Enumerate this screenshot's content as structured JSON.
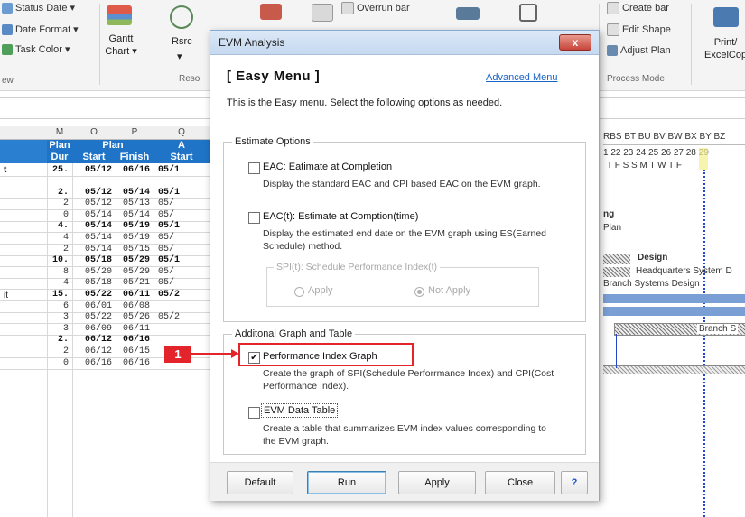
{
  "ribbon": {
    "status_date": "Status Date",
    "date_format": "Date Format",
    "task_color": "Task Color",
    "gantt_chart_line1": "Gantt",
    "gantt_chart_line2": "Chart",
    "rsrc": "Rsrc",
    "reso_group": "Reso",
    "overrun_bar": "Overrun bar",
    "create_bar": "Create bar",
    "edit_shape": "Edit Shape",
    "adjust_plan": "Adjust Plan",
    "process_mode": "Process Mode",
    "print_line1": "Print/",
    "print_line2": "ExcelCop",
    "view_group": "ew"
  },
  "sheet": {
    "col_letters": [
      "M",
      "O",
      "P",
      "Q"
    ],
    "header_plan": "Plan",
    "header_plan2": "Plan",
    "header_a": "A",
    "header_dur": "Dur",
    "header_start": "Start",
    "header_finish": "Finish",
    "header_start2": "Start",
    "total_marker": "t",
    "row_marker": "it",
    "rows": [
      {
        "dur": "25.",
        "start": "05/12",
        "finish": "06/16",
        "start2": "05/1",
        "bold": true
      },
      {
        "dur": "2.",
        "start": "05/12",
        "finish": "05/14",
        "start2": "05/1",
        "bold": true
      },
      {
        "dur": "2",
        "start": "05/12",
        "finish": "05/13",
        "start2": "05/",
        "bold": false
      },
      {
        "dur": "0",
        "start": "05/14",
        "finish": "05/14",
        "start2": "05/",
        "bold": false
      },
      {
        "dur": "4.",
        "start": "05/14",
        "finish": "05/19",
        "start2": "05/1",
        "bold": true
      },
      {
        "dur": "4",
        "start": "05/14",
        "finish": "05/19",
        "start2": "05/",
        "bold": false
      },
      {
        "dur": "2",
        "start": "05/14",
        "finish": "05/15",
        "start2": "05/",
        "bold": false
      },
      {
        "dur": "10.",
        "start": "05/18",
        "finish": "05/29",
        "start2": "05/1",
        "bold": true
      },
      {
        "dur": "8",
        "start": "05/20",
        "finish": "05/29",
        "start2": "05/",
        "bold": false
      },
      {
        "dur": "4",
        "start": "05/18",
        "finish": "05/21",
        "start2": "05/",
        "bold": false
      },
      {
        "dur": "15.",
        "start": "05/22",
        "finish": "06/11",
        "start2": "05/2",
        "bold": true
      },
      {
        "dur": "6",
        "start": "06/01",
        "finish": "06/08",
        "start2": "",
        "bold": false
      },
      {
        "dur": "3",
        "start": "05/22",
        "finish": "05/26",
        "start2": "05/2",
        "bold": false
      },
      {
        "dur": "3",
        "start": "06/09",
        "finish": "06/11",
        "start2": "",
        "bold": false
      },
      {
        "dur": "2.",
        "start": "06/12",
        "finish": "06/16",
        "start2": "",
        "bold": true
      },
      {
        "dur": "2",
        "start": "06/12",
        "finish": "06/15",
        "start2": "",
        "bold": false
      },
      {
        "dur": "0",
        "start": "06/16",
        "finish": "06/16",
        "start2": "",
        "bold": false
      }
    ]
  },
  "gantt": {
    "col_letters": "RBS BT BU BV BW BX BY BZ",
    "day_numbers": "1 22 23 24 25 26 27 28 29",
    "weekdays": "T F S S M T W T F",
    "ng_label": "ng",
    "plan_label": "Plan",
    "design_label": "Design",
    "hq_label": "Headquarters System D",
    "branch_design_label": "Branch Systems Design",
    "branch_s_label": "Branch S"
  },
  "dialog": {
    "title": "EVM Analysis",
    "close_glyph": "x",
    "easy_menu_title": "[ Easy Menu ]",
    "advanced_link": "Advanced Menu",
    "description": "This is the Easy menu. Select the following options as needed.",
    "estimate_group": "Estimate Options",
    "eac_label": "EAC: Eatimate at Completion",
    "eac_desc": "Display the standard EAC and CPI based EAC on the EVM graph.",
    "eact_label": "EAC(t): Estimate at Comption(time)",
    "eact_desc": "Display the estimated end date on the EVM graph using ES(Earned Schedule) method.",
    "spi_group": "SPI(t): Schedule Performance Index(t)",
    "apply_radio": "Apply",
    "not_apply_radio": "Not Apply",
    "additional_group": "Additonal Graph and Table",
    "pig_label": "Performance Index Graph",
    "pig_checked": "✔",
    "pig_desc": "Create the graph of SPI(Schedule Perforrmance Index) and CPI(Cost Performance Index).",
    "evm_table_label": "EVM Data Table",
    "evm_table_desc": "Create a table that summarizes EVM index values corresponding to the EVM graph.",
    "buttons": {
      "default": "Default",
      "run": "Run",
      "apply": "Apply",
      "close": "Close",
      "help": "?"
    }
  },
  "callout": {
    "number": "1"
  },
  "colors": {
    "header_blue": "#1f74c7",
    "callout_red": "#e3242b",
    "link_blue": "#1a63c9"
  }
}
